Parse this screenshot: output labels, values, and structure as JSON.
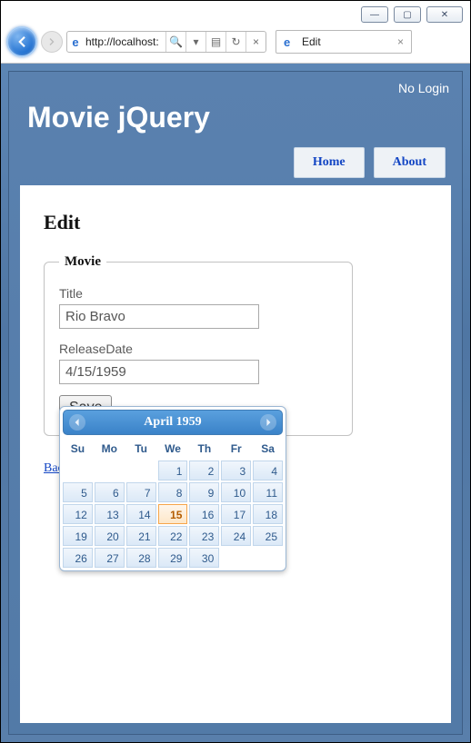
{
  "window": {
    "minimize_glyph": "—",
    "maximize_glyph": "▢",
    "close_glyph": "✕"
  },
  "browser": {
    "url": "http://localhost:",
    "search_icon_glyph": "🔍",
    "tab": {
      "title": "Edit",
      "close_glyph": "×"
    },
    "compat_glyph": "▤",
    "refresh_glyph": "↻",
    "stop_glyph": "×",
    "dropdown_glyph": "▾"
  },
  "header": {
    "login_text": "No Login",
    "brand": "Movie jQuery",
    "nav": {
      "home": "Home",
      "about": "About"
    }
  },
  "page": {
    "title": "Edit",
    "legend": "Movie",
    "fields": {
      "title_label": "Title",
      "title_value": "Rio Bravo",
      "release_label": "ReleaseDate",
      "release_value": "4/15/1959"
    },
    "save_label": "Save",
    "back_link": "Back to List"
  },
  "datepicker": {
    "month_label": "April 1959",
    "dow": [
      "Su",
      "Mo",
      "Tu",
      "We",
      "Th",
      "Fr",
      "Sa"
    ],
    "leading_blanks": 3,
    "days": 30,
    "selected": 15
  }
}
